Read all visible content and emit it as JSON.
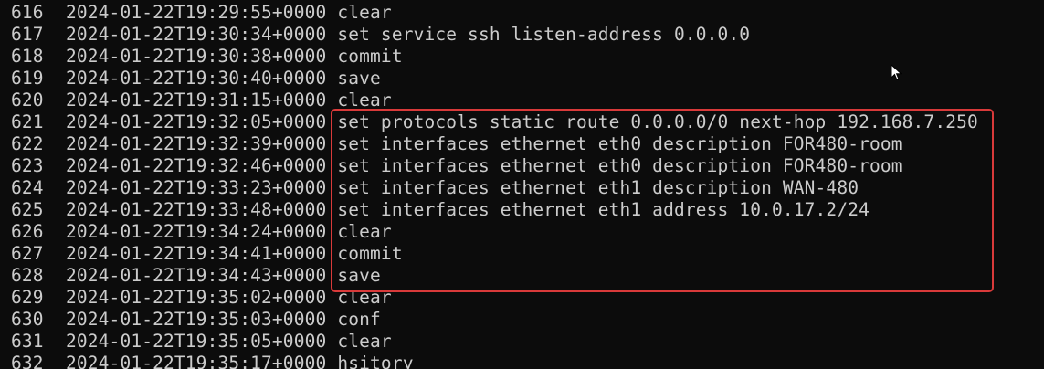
{
  "colors": {
    "background": "#0c0c0c",
    "text": "#cccccc",
    "highlight_border": "#d93a3a"
  },
  "icons": {
    "cursor": "mouse-pointer-icon"
  },
  "history": [
    {
      "num": "616",
      "time": "2024-01-22T19:29:55+0000",
      "cmd": "clear"
    },
    {
      "num": "617",
      "time": "2024-01-22T19:30:34+0000",
      "cmd": "set service ssh listen-address 0.0.0.0"
    },
    {
      "num": "618",
      "time": "2024-01-22T19:30:38+0000",
      "cmd": "commit"
    },
    {
      "num": "619",
      "time": "2024-01-22T19:30:40+0000",
      "cmd": "save"
    },
    {
      "num": "620",
      "time": "2024-01-22T19:31:15+0000",
      "cmd": "clear"
    },
    {
      "num": "621",
      "time": "2024-01-22T19:32:05+0000",
      "cmd": "set protocols static route 0.0.0.0/0 next-hop 192.168.7.250"
    },
    {
      "num": "622",
      "time": "2024-01-22T19:32:39+0000",
      "cmd": "set interfaces ethernet eth0 description FOR480-room"
    },
    {
      "num": "623",
      "time": "2024-01-22T19:32:46+0000",
      "cmd": "set interfaces ethernet eth0 description FOR480-room"
    },
    {
      "num": "624",
      "time": "2024-01-22T19:33:23+0000",
      "cmd": "set interfaces ethernet eth1 description WAN-480"
    },
    {
      "num": "625",
      "time": "2024-01-22T19:33:48+0000",
      "cmd": "set interfaces ethernet eth1 address 10.0.17.2/24"
    },
    {
      "num": "626",
      "time": "2024-01-22T19:34:24+0000",
      "cmd": "clear"
    },
    {
      "num": "627",
      "time": "2024-01-22T19:34:41+0000",
      "cmd": "commit"
    },
    {
      "num": "628",
      "time": "2024-01-22T19:34:43+0000",
      "cmd": "save"
    },
    {
      "num": "629",
      "time": "2024-01-22T19:35:02+0000",
      "cmd": "clear"
    },
    {
      "num": "630",
      "time": "2024-01-22T19:35:03+0000",
      "cmd": "conf"
    },
    {
      "num": "631",
      "time": "2024-01-22T19:35:05+0000",
      "cmd": "clear"
    },
    {
      "num": "632",
      "time": "2024-01-22T19:35:17+0000",
      "cmd": "hsitory"
    }
  ]
}
